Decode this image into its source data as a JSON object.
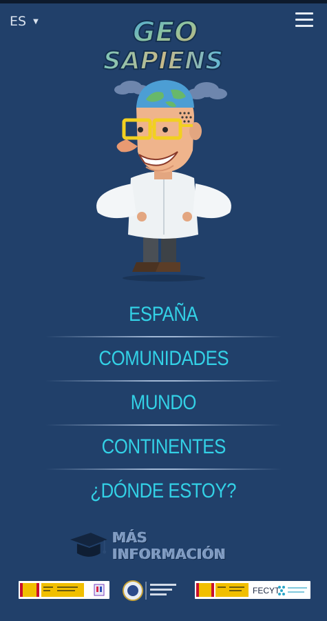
{
  "app": {
    "title": "Geo Sapiens",
    "logo_line1": "GEO",
    "logo_line2": "SAPIENS"
  },
  "header": {
    "language": "ES",
    "language_caret_icon": "caret-down-icon",
    "menu_icon": "hamburger-menu-icon"
  },
  "main_menu": {
    "items": [
      {
        "label": "ESPAÑA"
      },
      {
        "label": "COMUNIDADES"
      },
      {
        "label": "MUNDO"
      },
      {
        "label": "CONTINENTES"
      },
      {
        "label": "¿DÓNDE ESTOY?"
      }
    ]
  },
  "more_info": {
    "label": "MÁS INFORMACIÓN",
    "icon": "graduation-cap-icon"
  },
  "footer": {
    "logos": [
      {
        "name": "ministerio-logo"
      },
      {
        "name": "upm-logo"
      },
      {
        "name": "fecyt-logo"
      }
    ],
    "fecyt_text": "FECYT"
  },
  "colors": {
    "background": "#21406a",
    "menu_text": "#33d1e6",
    "separator": "#b9cde8"
  }
}
